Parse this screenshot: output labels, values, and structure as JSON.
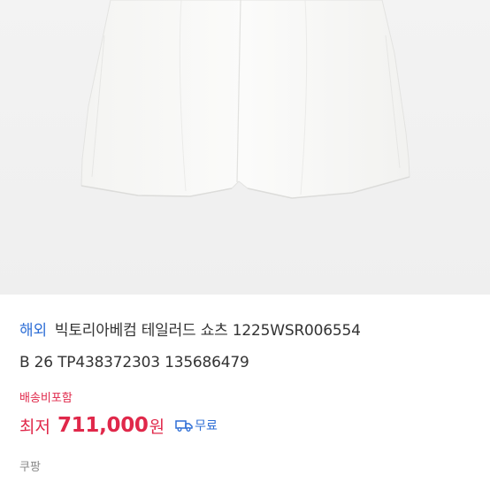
{
  "product": {
    "image_alt": "white tailored shorts",
    "overseas_tag": "해외",
    "title_line1": "빅토리아베컴 테일러드 쇼츠 1225WSR006554",
    "title_line2": "B 26 TP438372303 135686479",
    "shipping_note": "배송비포함",
    "price_prefix": "최저",
    "price_value": "711,000",
    "price_unit": "원",
    "delivery_label": "무료",
    "delivery_icon": "truck-icon",
    "seller": "쿠팡"
  },
  "colors": {
    "accent_red": "#e0284a",
    "accent_blue": "#2f6fd6",
    "image_bg": "#f0f0f0"
  }
}
